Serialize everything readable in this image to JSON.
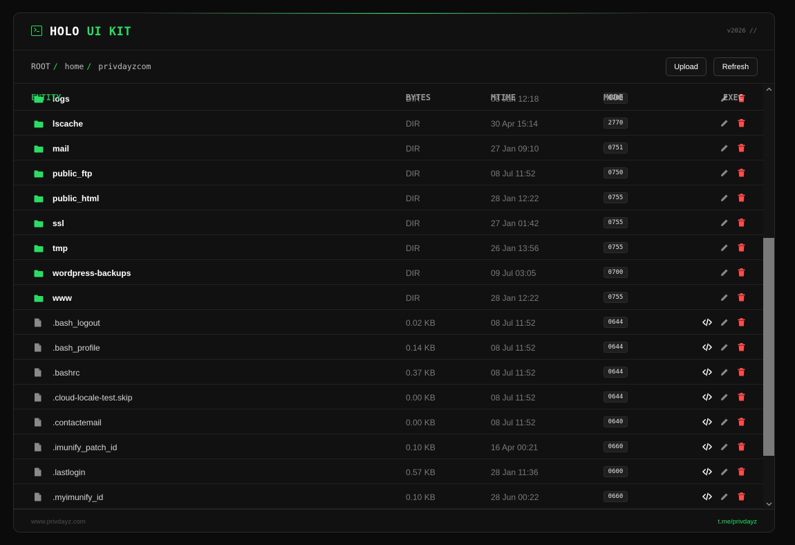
{
  "header": {
    "brand_prefix": "HOLO",
    "brand_accent": "UI KIT",
    "version": "v2026 //"
  },
  "breadcrumb": [
    "ROOT",
    "home",
    "privdayzcom"
  ],
  "toolbar": {
    "upload_label": "Upload",
    "refresh_label": "Refresh"
  },
  "table": {
    "columns": [
      "ENTITY",
      "BYTES",
      "MTIME",
      "MODE",
      "EXEC"
    ],
    "rows": [
      {
        "name": "logs",
        "type": "dir",
        "size": "DIR",
        "mtime": "08 Jan 12:18",
        "mode": "0700"
      },
      {
        "name": "lscache",
        "type": "dir",
        "size": "DIR",
        "mtime": "30 Apr 15:14",
        "mode": "2770"
      },
      {
        "name": "mail",
        "type": "dir",
        "size": "DIR",
        "mtime": "27 Jan 09:10",
        "mode": "0751"
      },
      {
        "name": "public_ftp",
        "type": "dir",
        "size": "DIR",
        "mtime": "08 Jul 11:52",
        "mode": "0750"
      },
      {
        "name": "public_html",
        "type": "dir",
        "size": "DIR",
        "mtime": "28 Jan 12:22",
        "mode": "0755"
      },
      {
        "name": "ssl",
        "type": "dir",
        "size": "DIR",
        "mtime": "27 Jan 01:42",
        "mode": "0755"
      },
      {
        "name": "tmp",
        "type": "dir",
        "size": "DIR",
        "mtime": "26 Jan 13:56",
        "mode": "0755"
      },
      {
        "name": "wordpress-backups",
        "type": "dir",
        "size": "DIR",
        "mtime": "09 Jul 03:05",
        "mode": "0700"
      },
      {
        "name": "www",
        "type": "dir",
        "size": "DIR",
        "mtime": "28 Jan 12:22",
        "mode": "0755"
      },
      {
        "name": ".bash_logout",
        "type": "file",
        "size": "0.02 KB",
        "mtime": "08 Jul 11:52",
        "mode": "0644"
      },
      {
        "name": ".bash_profile",
        "type": "file",
        "size": "0.14 KB",
        "mtime": "08 Jul 11:52",
        "mode": "0644"
      },
      {
        "name": ".bashrc",
        "type": "file",
        "size": "0.37 KB",
        "mtime": "08 Jul 11:52",
        "mode": "0644"
      },
      {
        "name": ".cloud-locale-test.skip",
        "type": "file",
        "size": "0.00 KB",
        "mtime": "08 Jul 11:52",
        "mode": "0644"
      },
      {
        "name": ".contactemail",
        "type": "file",
        "size": "0.00 KB",
        "mtime": "08 Jul 11:52",
        "mode": "0640"
      },
      {
        "name": ".imunify_patch_id",
        "type": "file",
        "size": "0.10 KB",
        "mtime": "16 Apr 00:21",
        "mode": "0660"
      },
      {
        "name": ".lastlogin",
        "type": "file",
        "size": "0.57 KB",
        "mtime": "28 Jan 11:36",
        "mode": "0600"
      },
      {
        "name": ".myimunify_id",
        "type": "file",
        "size": "0.10 KB",
        "mtime": "28 Jun 00:22",
        "mode": "0660"
      }
    ]
  },
  "footer": {
    "left": "www.privdayz.com",
    "right": "t.me/privdayz"
  },
  "colors": {
    "accent": "#2bdc64",
    "danger": "#ff4d4d",
    "background": "#111111"
  }
}
